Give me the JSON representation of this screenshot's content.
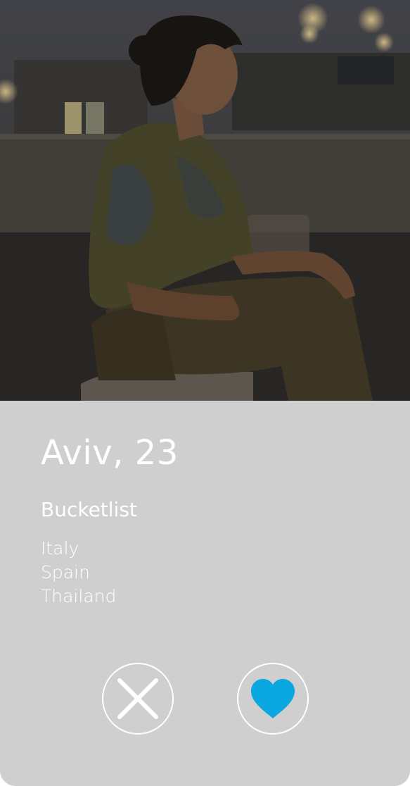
{
  "profile": {
    "name_age": "Aviv, 23",
    "section_title": "Bucketlist",
    "bucketlist": [
      "Italy",
      "Spain",
      "Thailand"
    ]
  },
  "photo": {
    "alt": "Profile photo"
  },
  "actions": {
    "dislike_icon": "close-icon",
    "like_icon": "heart-icon",
    "like_color": "#0aa7e0"
  },
  "colors": {
    "card_background": "#cfcfcf",
    "text": "#ffffff",
    "accent": "#0aa7e0"
  }
}
